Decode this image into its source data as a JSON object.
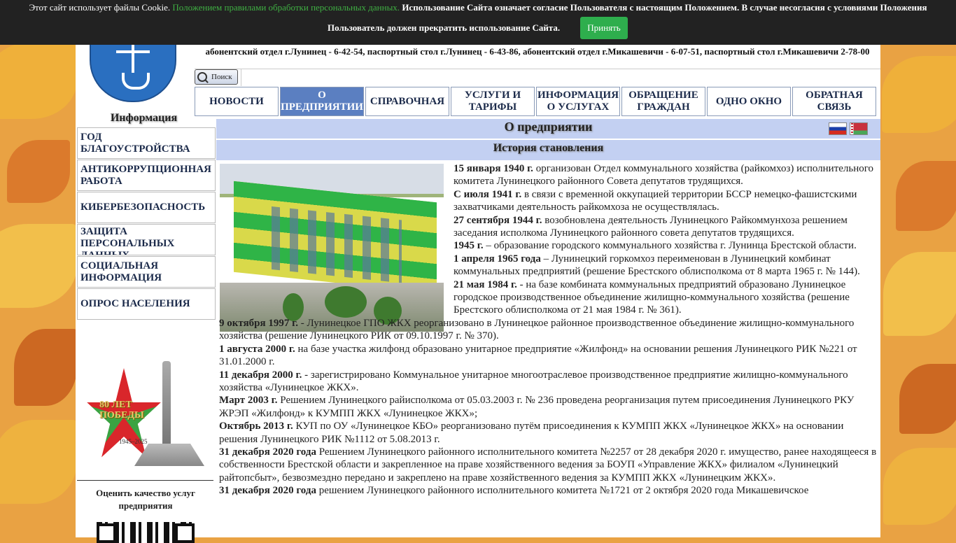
{
  "cookie": {
    "text_before": "Этот сайт использует файлы Cookie. ",
    "link_text": "Положением правилами обработки персональных данных.",
    "text_bold": " Использование Сайта означает согласие Пользователя с настоящим Положением. В случае несогласия с условиями Положения",
    "line2": "Пользователь должен прекратить использование Сайта.",
    "accept_label": "Принять",
    "link_color": "#3fb043",
    "button_color": "#2eae4d"
  },
  "header": {
    "phones": "абонентский отдел г.Лунинец - 6-42-54, паспортный стол г.Лунинец - 6-43-86, абонентский отдел г.Микашевичи - 6-07-51, паспортный стол г.Микашевичи 2-78-00",
    "search_label": "Поиск",
    "info_title": "Информация"
  },
  "nav": [
    {
      "label": "НОВОСТИ",
      "active": false
    },
    {
      "label": "О ПРЕДПРИЯТИИ",
      "active": true
    },
    {
      "label": "СПРАВОЧНАЯ",
      "active": false
    },
    {
      "label": "УСЛУГИ И ТАРИФЫ",
      "active": false
    },
    {
      "label": "ИНФОРМАЦИЯ О УСЛУГАХ",
      "active": false
    },
    {
      "label": "ОБРАЩЕНИЕ ГРАЖДАН",
      "active": false
    },
    {
      "label": "ОДНО ОКНО",
      "active": false
    },
    {
      "label": "ОБРАТНАЯ СВЯЗЬ",
      "active": false
    }
  ],
  "sidebar": {
    "items": [
      {
        "label": "ГОД БЛАГОУСТРОЙСТВА"
      },
      {
        "label": "АНТИКОРРУПЦИОННАЯ РАБОТА"
      },
      {
        "label": "КИБЕРБЕЗОПАСНОСТЬ"
      },
      {
        "label": "ЗАЩИТА ПЕРСОНАЛЬНЫХ ДАННЫХ"
      },
      {
        "label": "СОЦИАЛЬНАЯ ИНФОРМАЦИЯ"
      },
      {
        "label": "ОПРОС НАСЕЛЕНИЯ"
      }
    ],
    "victory_num": "80 ЛЕТ ПОБЕДЫ",
    "victory_years": "1945–2025",
    "rate_text": "Оценить качество услуг предприятия"
  },
  "content": {
    "title": "О предприятии",
    "subtitle": "История становления",
    "history": [
      {
        "date": "15 января 1940 г.",
        "text": " организован Отдел коммунального хозяйства (райкомхоз) исполнительного комитета Лунинецкого районного Совета депутатов трудящихся."
      },
      {
        "date": "С июля 1941 г.",
        "text": " в связи с временной оккупацией территории БССР немецко-фашистскими захватчиками деятельность райкомхоза не осуществлялась."
      },
      {
        "date": "27 сентября 1944 г.",
        "text": " возобновлена деятельность Лунинецкого Райкоммунхоза решением заседания исполкома Лунинецкого районного совета депутатов трудящихся."
      },
      {
        "date": "1945 г.",
        "text": " – образование городского коммунального хозяйства г. Лунинца Брестской области."
      },
      {
        "date": "1 апреля 1965 года",
        "text": " – Лунинецкий горкомхоз переименован  в Лунинецкий комбинат коммунальных предприятий (решение Брестского облисполкома от 8 марта 1965 г. № 144)."
      },
      {
        "date": "21 мая 1984 г.",
        "text": " - на базе комбината коммунальных предприятий образовано Лунинецкое городское производственное объединение жилищно-коммунального хозяйства (решение Брестского облисполкома от 21 мая 1984 г. № 361)."
      },
      {
        "date": "9 октября 1997 г.",
        "text": " - Лунинецкое ГПО ЖКХ реорганизовано в Лунинецкое районное производственное объединение жилищно-коммунального хозяйства (решение Лунинецкого РИК от 09.10.1997 г. № 370)."
      },
      {
        "date": "1 августа 2000 г.",
        "text": " на базе участка жилфонд образовано унитарное предприятие «Жилфонд» на основании решения Лунинецкого РИК №221 от 31.01.2000 г."
      },
      {
        "date": "11 декабря 2000 г.",
        "text": " - зарегистрировано Коммунальное унитарное многоотраслевое производственное предприятие жилищно-коммунального хозяйства «Лунинецкое ЖКХ»."
      },
      {
        "date": "Март 2003 г.",
        "text": " Решением Лунинецкого райисполкома от 05.03.2003 г. № 236 проведена реорганизация путем присоединения Лунинецкого РКУ ЖРЭП «Жилфонд» к КУМПП ЖКХ «Лунинецкое ЖКХ»;"
      },
      {
        "date": "Октябрь 2013 г.",
        "text": " КУП по ОУ «Лунинецкое КБО» реорганизовано путём присоединения к КУМПП ЖКХ «Лунинецкое ЖКХ» на основании решения Лунинецкого РИК №1112 от 5.08.2013 г."
      },
      {
        "date": "31 декабря 2020 года",
        "text": "  Решением Лунинецкого районного исполнительного комитета №2257 от 28 декабря 2020 г. имущество, ранее находящееся в собственности Брестской области и закрепленное на праве хозяйственного ведения за БОУП «Управление ЖКХ» филиалом «Лунинецкий райтопсбыт», безвозмездно передано и закреплено на праве хозяйственного ведения за КУМПП ЖКХ «Лунинецким ЖКХ»."
      },
      {
        "date": "31 декабря 2020 года",
        "text": " решением Лунинецкого районного исполнительного комитета №1721 от 2 октября 2020 года Микашевичское"
      }
    ]
  }
}
